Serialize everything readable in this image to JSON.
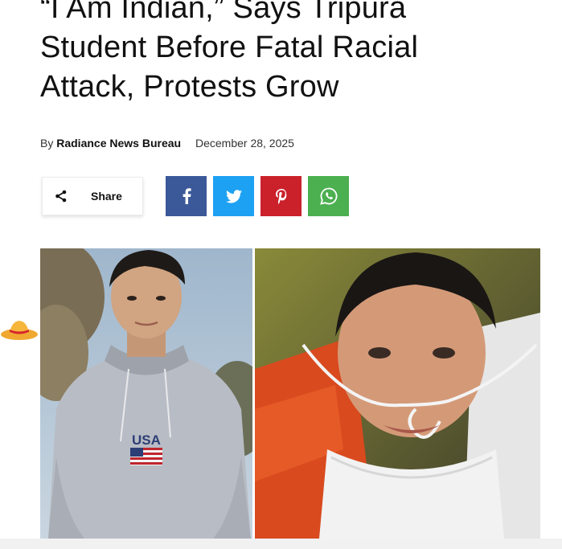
{
  "article": {
    "headline_lines": [
      "“I Am Indian,” Says Tripura",
      "Student Before Fatal Racial",
      "Attack, Protests Grow"
    ],
    "byline_prefix": "By",
    "author": "Radiance News Bureau",
    "date": "December 28, 2025"
  },
  "share": {
    "label": "Share",
    "icon": "share-icon"
  },
  "social": [
    {
      "name": "facebook",
      "glyph": "f",
      "color": "#3b5998"
    },
    {
      "name": "twitter",
      "icon": "twitter-bird-icon",
      "color": "#1da1f2"
    },
    {
      "name": "pinterest",
      "glyph": "p",
      "color": "#ca212a"
    },
    {
      "name": "whatsapp",
      "icon": "whatsapp-icon",
      "color": "#4caf50"
    }
  ],
  "photos": {
    "left_shirt_text": "USA"
  },
  "colors": {
    "text": "#111111",
    "facebook": "#3b5998",
    "twitter": "#1da1f2",
    "pinterest": "#ca212a",
    "whatsapp": "#4caf50"
  }
}
